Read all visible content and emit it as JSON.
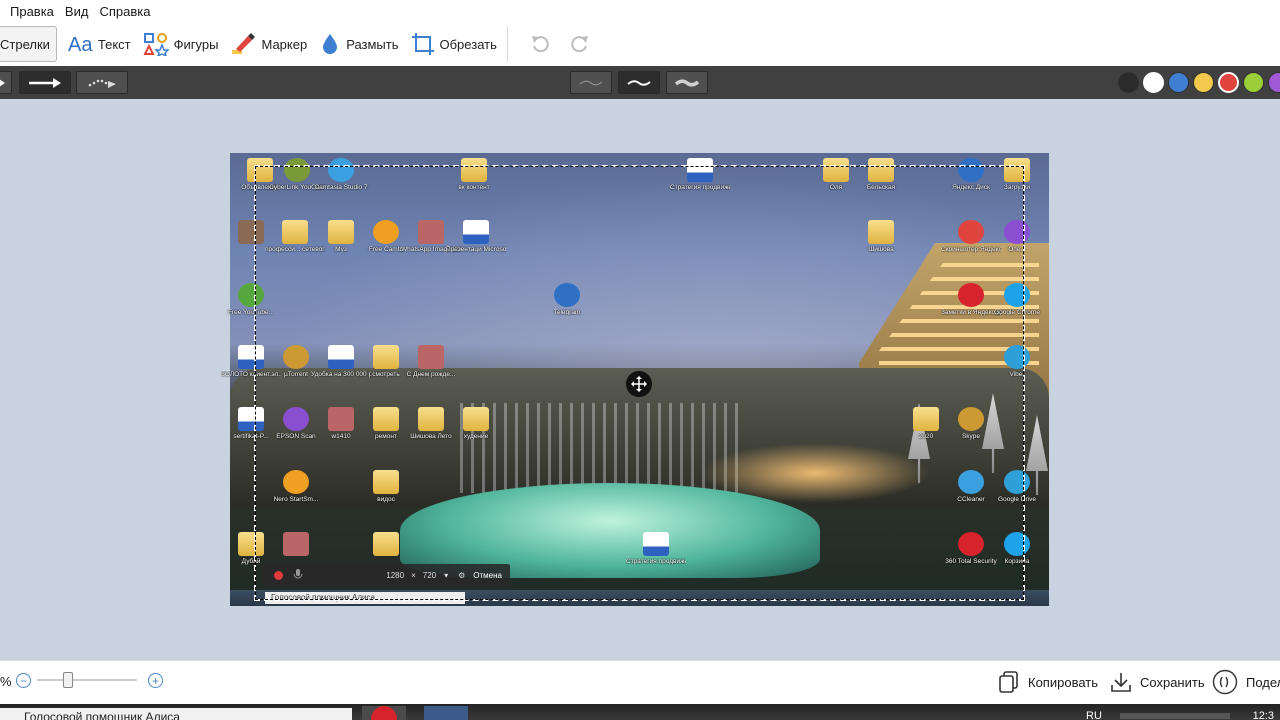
{
  "menu": [
    "Правка",
    "Вид",
    "Справка"
  ],
  "toolbar": {
    "tools": [
      {
        "label": "Стрелки",
        "icon": "arrows-icon",
        "active": true
      },
      {
        "label": "Текст",
        "icon": "text-icon"
      },
      {
        "label": "Фигуры",
        "icon": "shapes-icon"
      },
      {
        "label": "Маркер",
        "icon": "marker-icon"
      },
      {
        "label": "Размыть",
        "icon": "blur-drop-icon"
      },
      {
        "label": "Обрезать",
        "icon": "crop-icon"
      }
    ],
    "undo_icon": "undo-icon",
    "redo_icon": "redo-icon"
  },
  "options": {
    "arrow_styles": [
      "arrow-left-partial",
      "arrow-straight",
      "arrow-dotted"
    ],
    "stroke_widths": [
      "thin",
      "medium",
      "thick"
    ],
    "palette": [
      "#2b2b2b",
      "#ffffff",
      "#3f7fd1",
      "#f2c94c",
      "#e0443e",
      "#9bcf3a",
      "#a05ad6"
    ]
  },
  "screenshot": {
    "icons": [
      {
        "label": "Объявления",
        "kind": "folder"
      },
      {
        "label": "CyberLink YouCam",
        "kind": "app"
      },
      {
        "label": "Camtasia Studio 7",
        "kind": "app"
      },
      {
        "label": "вк контент",
        "kind": "folder"
      },
      {
        "label": "Стратегия продвиже...",
        "kind": "doc"
      },
      {
        "label": "Оля",
        "kind": "folder"
      },
      {
        "label": "Бельская",
        "kind": "folder"
      },
      {
        "label": "Яндекс.Диск",
        "kind": "app"
      },
      {
        "label": "Загрузки",
        "kind": "folder"
      },
      {
        "label": "",
        "kind": "photo"
      },
      {
        "label": "професси... сетевого м...",
        "kind": "folder"
      },
      {
        "label": "Муз",
        "kind": "folder"
      },
      {
        "label": "Free Camtd",
        "kind": "app"
      },
      {
        "label": "WhatsApp Image 2019...",
        "kind": "image"
      },
      {
        "label": "Презентаци Microsoft P...",
        "kind": "doc"
      },
      {
        "label": "Шишова",
        "kind": "folder"
      },
      {
        "label": "Скриншотер Яндекс.Диск",
        "kind": "app"
      },
      {
        "label": "Опе...",
        "kind": "app"
      },
      {
        "label": "Free YouTube...",
        "kind": "app"
      },
      {
        "label": "Telegram",
        "kind": "app"
      },
      {
        "label": "Заметки в Яндекс.Ди...",
        "kind": "app"
      },
      {
        "label": "Google Chrome",
        "kind": "app"
      },
      {
        "label": "ЗОЛОТО клиент.эл...",
        "kind": "doc"
      },
      {
        "label": "µTorrent",
        "kind": "app"
      },
      {
        "label": "Удобка на 300 000 руб",
        "kind": "doc"
      },
      {
        "label": "смотреть",
        "kind": "folder"
      },
      {
        "label": "С Днем рожде...",
        "kind": "image"
      },
      {
        "label": "Viber",
        "kind": "app"
      },
      {
        "label": "sertifikat-P...",
        "kind": "doc"
      },
      {
        "label": "EPSON Scan",
        "kind": "app"
      },
      {
        "label": "w1410",
        "kind": "image"
      },
      {
        "label": "ремонт",
        "kind": "folder"
      },
      {
        "label": "Шишова Лето",
        "kind": "folder"
      },
      {
        "label": "худение",
        "kind": "folder"
      },
      {
        "label": "2020",
        "kind": "folder"
      },
      {
        "label": "Skype",
        "kind": "app"
      },
      {
        "label": "Nero StartSm...",
        "kind": "app"
      },
      {
        "label": "видос",
        "kind": "folder"
      },
      {
        "label": "CCleaner",
        "kind": "app"
      },
      {
        "label": "Google Drive",
        "kind": "app"
      },
      {
        "label": "Дубай",
        "kind": "folder"
      },
      {
        "label": "",
        "kind": "image"
      },
      {
        "label": "",
        "kind": "folder"
      },
      {
        "label": "Стратегия продвиже...",
        "kind": "doc"
      },
      {
        "label": "360 Total Security",
        "kind": "app"
      },
      {
        "label": "Корзина",
        "kind": "app"
      }
    ],
    "recorder": {
      "width": "1280",
      "times": "×",
      "height": "720",
      "cancel": "Отмена"
    },
    "taskbar_search": "Голосовой помощник Алиса"
  },
  "statusbar": {
    "zoom_suffix": "%",
    "zoom_level": 0.3,
    "copy": "Копировать",
    "save": "Сохранить",
    "share": "Подел"
  },
  "os_taskbar": {
    "search_text": "Голосовой помощник Алиса",
    "lang": "RU",
    "clock": "12:3"
  }
}
